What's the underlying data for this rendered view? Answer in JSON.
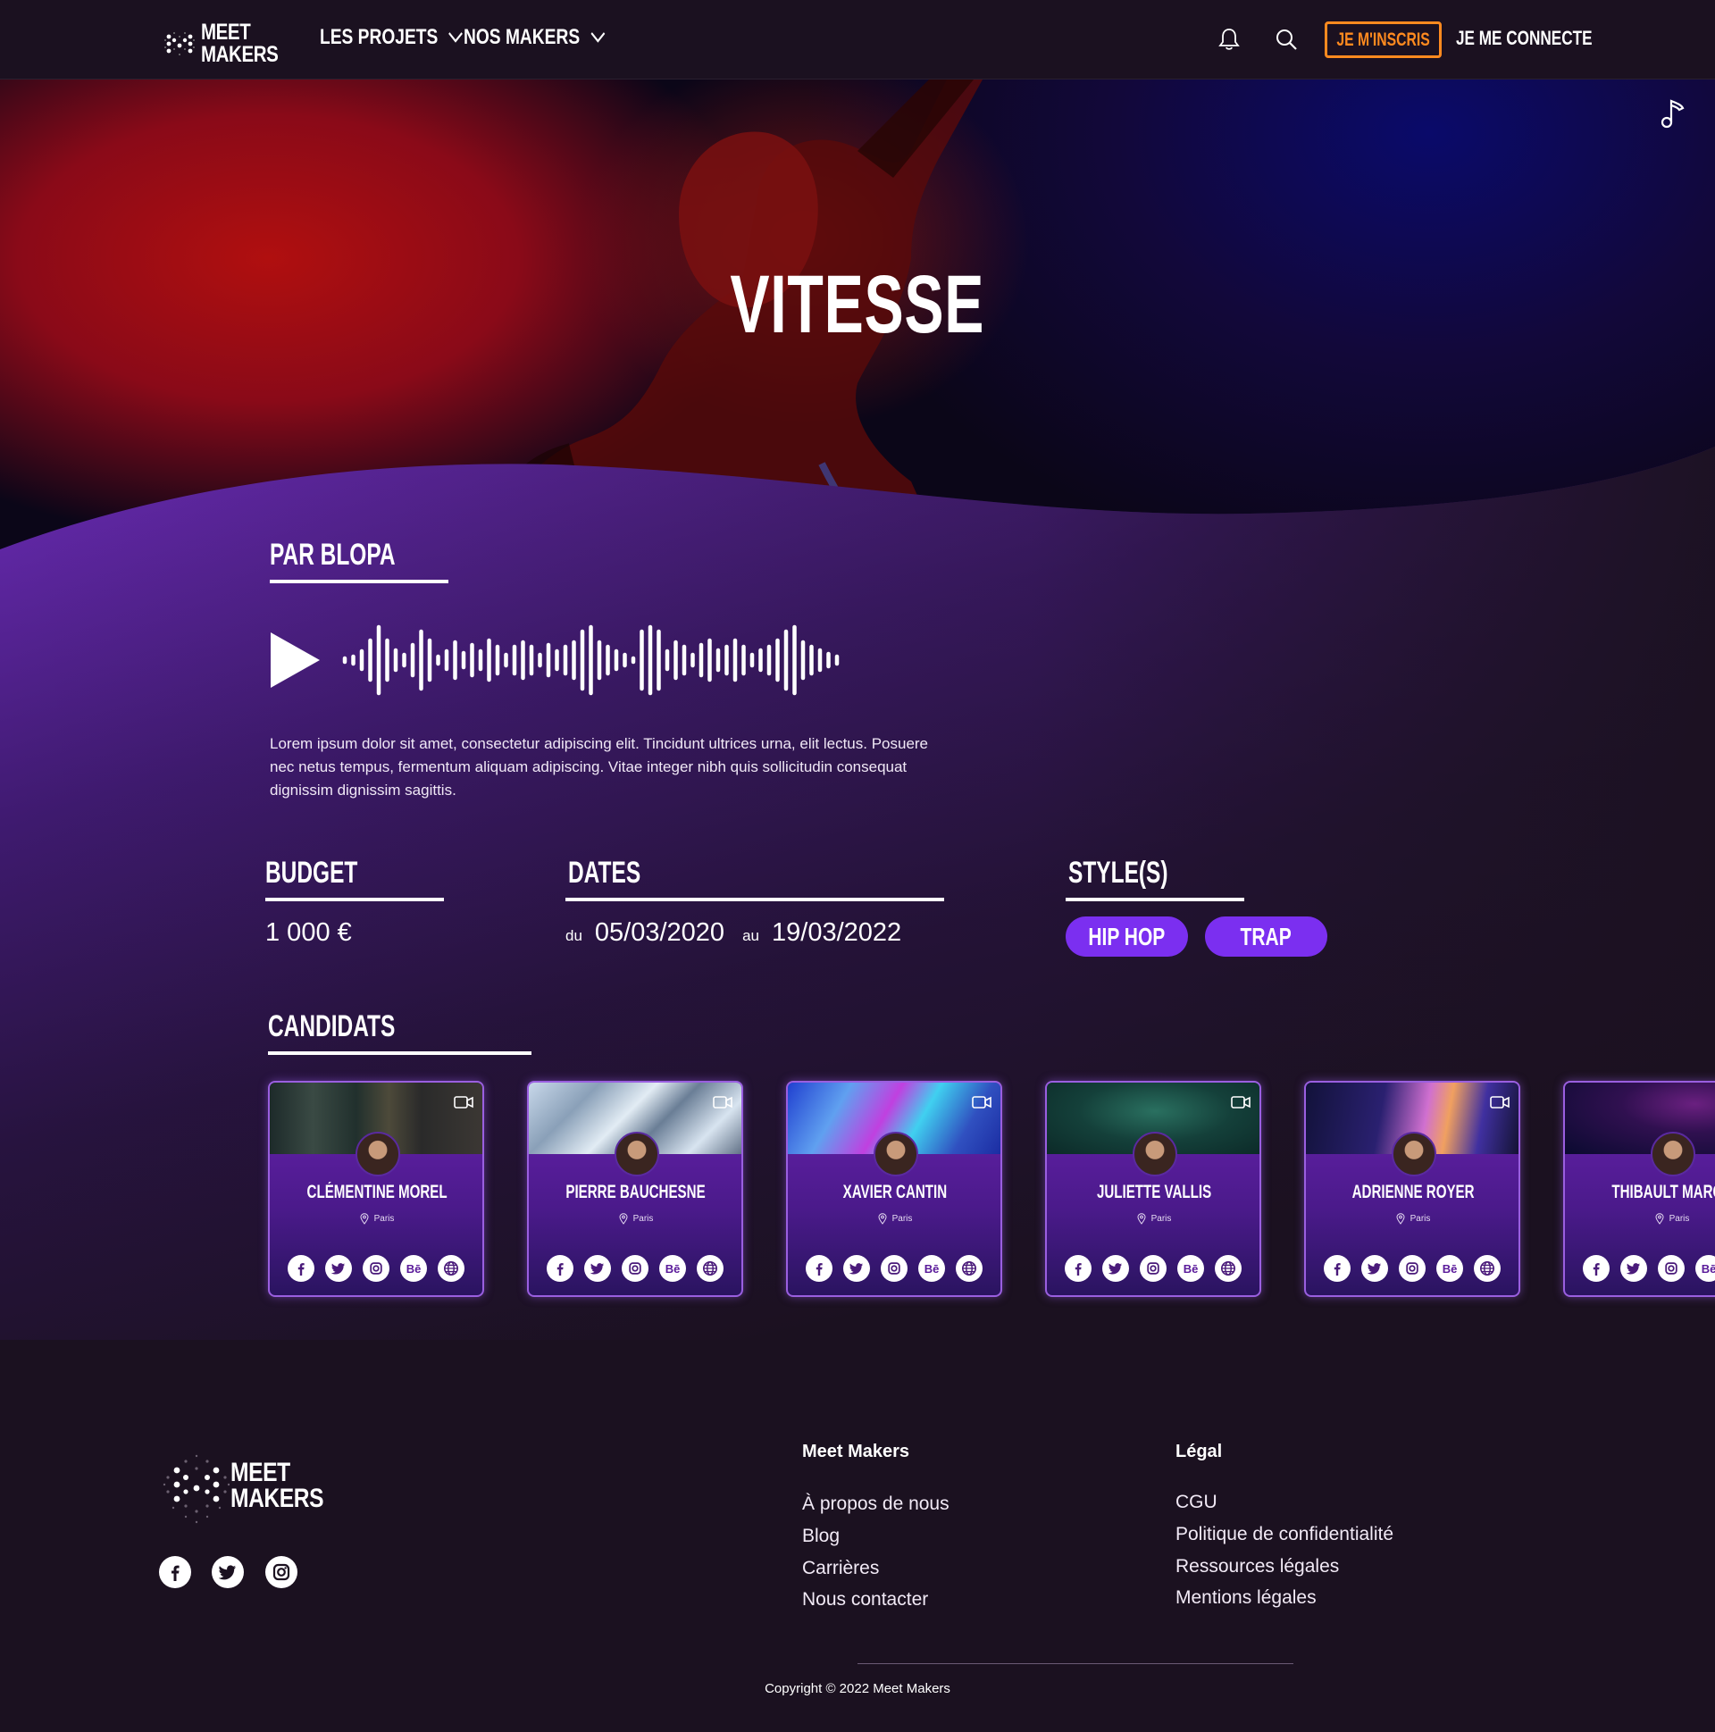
{
  "header": {
    "logo_line1": "MEET",
    "logo_line2": "MAKERS",
    "nav": [
      {
        "label": "LES PROJETS"
      },
      {
        "label": "NOS MAKERS"
      }
    ],
    "signup_label": "JE M'INSCRIS",
    "login_label": "JE ME CONNECTE",
    "accent_color": "#ff8a1f"
  },
  "hero": {
    "title": "VITESSE"
  },
  "project": {
    "author_title": "PAR BLOPA",
    "description": "Lorem ipsum dolor sit amet, consectetur adipiscing elit. Tincidunt ultrices urna, elit lectus. Posuere nec netus tempus, fermentum aliquam adipiscing. Vitae integer nibh quis sollicitudin consequat dignissim dignissim sagittis.",
    "budget_title": "BUDGET",
    "budget_value": "1 000 €",
    "dates_title": "DATES",
    "date_from_label": "du",
    "date_from": "05/03/2020",
    "date_to_label": "au",
    "date_to": "19/03/2022",
    "styles_title": "STYLE(S)",
    "styles": [
      "HIP HOP",
      "TRAP"
    ],
    "pill_color": "#7b2ff0"
  },
  "candidates": {
    "title": "CANDIDATS",
    "items": [
      {
        "name": "CLÉMENTINE MOREL",
        "location": "Paris"
      },
      {
        "name": "PIERRE BAUCHESNE",
        "location": "Paris"
      },
      {
        "name": "XAVIER CANTIN",
        "location": "Paris"
      },
      {
        "name": "JULIETTE VALLIS",
        "location": "Paris"
      },
      {
        "name": "ADRIENNE ROYER",
        "location": "Paris"
      },
      {
        "name": "THIBAULT MARCO",
        "location": "Paris"
      }
    ],
    "socials": [
      "facebook-icon",
      "twitter-icon",
      "instagram-icon",
      "behance-icon",
      "globe-icon"
    ],
    "behance_text": "Bē"
  },
  "footer": {
    "logo_line1": "MEET",
    "logo_line2": "MAKERS",
    "col1_title": "Meet Makers",
    "col1_links": [
      "À propos de nous",
      "Blog",
      "Carrières",
      "Nous contacter"
    ],
    "col2_title": "Légal",
    "col2_links": [
      "CGU",
      "Politique de confidentialité",
      "Ressources légales",
      "Mentions légales"
    ],
    "copyright": "Copyright ©  2022 Meet Makers"
  }
}
